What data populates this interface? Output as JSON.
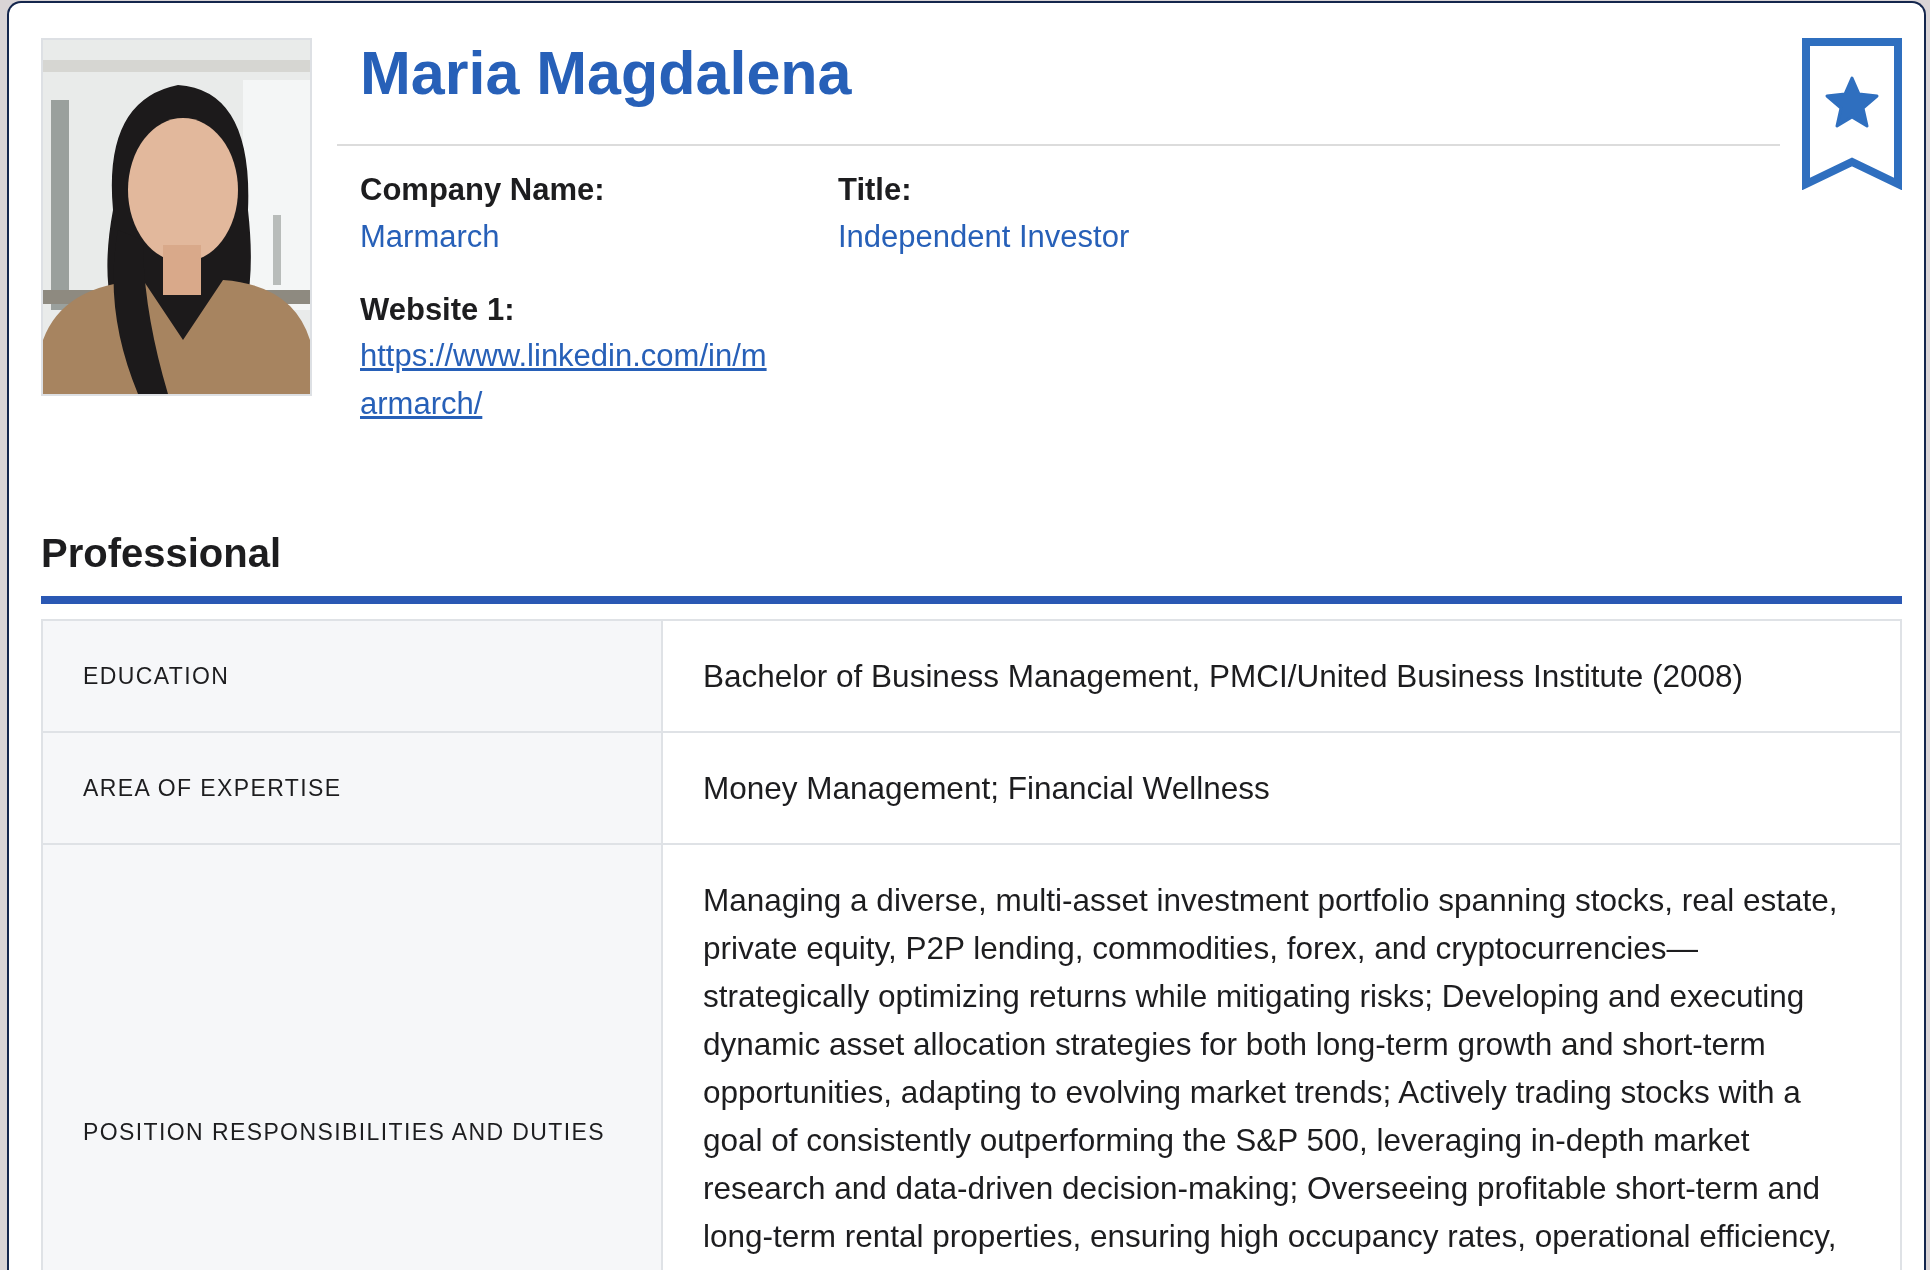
{
  "profile": {
    "name": "Maria Magdalena",
    "fields": [
      {
        "label": "Company Name:",
        "value": "Marmarch",
        "kind": "text"
      },
      {
        "label": "Title:",
        "value": "Independent Investor",
        "kind": "text"
      },
      {
        "label": "Website 1:",
        "value": "https://www.linkedin.com/in/marmarch/",
        "kind": "link"
      }
    ]
  },
  "section": {
    "title": "Professional",
    "rows": [
      {
        "label": "EDUCATION",
        "value": "Bachelor of Business Management, PMCI/United Business Institute (2008)"
      },
      {
        "label": "AREA OF EXPERTISE",
        "value": "Money Management; Financial Wellness"
      },
      {
        "label": "POSITION RESPONSIBILITIES AND DUTIES",
        "value": "Managing a diverse, multi-asset investment portfolio spanning stocks, real estate, private equity, P2P lending, commodities, forex, and cryptocurrencies—strategically optimizing returns while mitigating risks; Developing and executing dynamic asset allocation strategies for both long-term growth and short-term opportunities, adapting to evolving market trends; Actively trading stocks with a goal of consistently outperforming the S&P 500, leveraging in-depth market research and data-driven decision-making; Overseeing profitable short-term and long-term rental properties, ensuring high occupancy rates, operational efficiency,"
      }
    ]
  }
}
